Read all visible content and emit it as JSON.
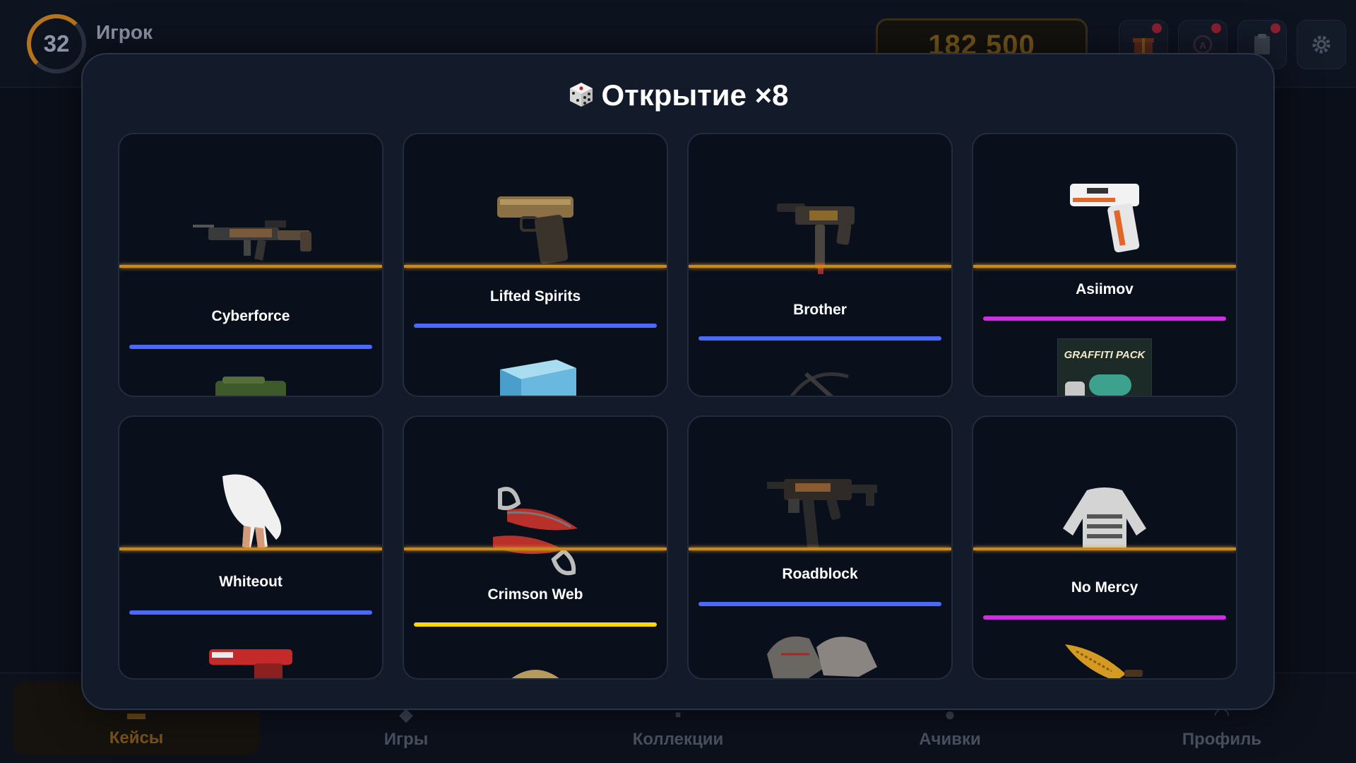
{
  "player": {
    "level": "32",
    "name": "Игрок"
  },
  "balance": "182 500",
  "header_icons": [
    "gift-icon",
    "badge-icon",
    "clipboard-icon",
    "gear-icon"
  ],
  "nav": [
    {
      "label": "Кейсы",
      "icon": "case-icon",
      "active": true
    },
    {
      "label": "Игры",
      "icon": "gamepad-icon",
      "active": false
    },
    {
      "label": "Коллекции",
      "icon": "collection-icon",
      "active": false
    },
    {
      "label": "Ачивки",
      "icon": "medal-icon",
      "active": false
    },
    {
      "label": "Профиль",
      "icon": "profile-icon",
      "active": false
    }
  ],
  "modal": {
    "title": "Открытие ×8",
    "title_icon": "dice-icon"
  },
  "colors": {
    "pointer": "#c98a17",
    "rarity_blue": "#4b69ff",
    "rarity_pink": "#d32ce6",
    "rarity_gold": "#ffd700"
  },
  "cards": [
    {
      "name": "Cyberforce",
      "rarity": "blue",
      "item_icon": "rifle-icon",
      "next_icon": "green-pistol-icon"
    },
    {
      "name": "Lifted Spirits",
      "rarity": "blue",
      "item_icon": "pistol-icon",
      "next_icon": "ice-block-icon"
    },
    {
      "name": "Brother",
      "rarity": "blue",
      "item_icon": "smg-icon",
      "next_icon": "crossbow-icon"
    },
    {
      "name": "Asiimov",
      "rarity": "pink",
      "item_icon": "white-pistol-icon",
      "next_icon": "graffiti-pack-icon",
      "next_text": "GRAFFITI PACK"
    },
    {
      "name": "Whiteout",
      "rarity": "blue",
      "item_icon": "glove-icon",
      "next_icon": "red-pistol-icon"
    },
    {
      "name": "Crimson Web",
      "rarity": "gold",
      "item_icon": "shadow-daggers-icon",
      "next_icon": "helmet-icon"
    },
    {
      "name": "Roadblock",
      "rarity": "blue",
      "item_icon": "ump-icon",
      "next_icon": "gloves-pair-icon"
    },
    {
      "name": "No Mercy",
      "rarity": "pink",
      "item_icon": "jacket-icon",
      "next_icon": "gold-knife-icon"
    }
  ]
}
